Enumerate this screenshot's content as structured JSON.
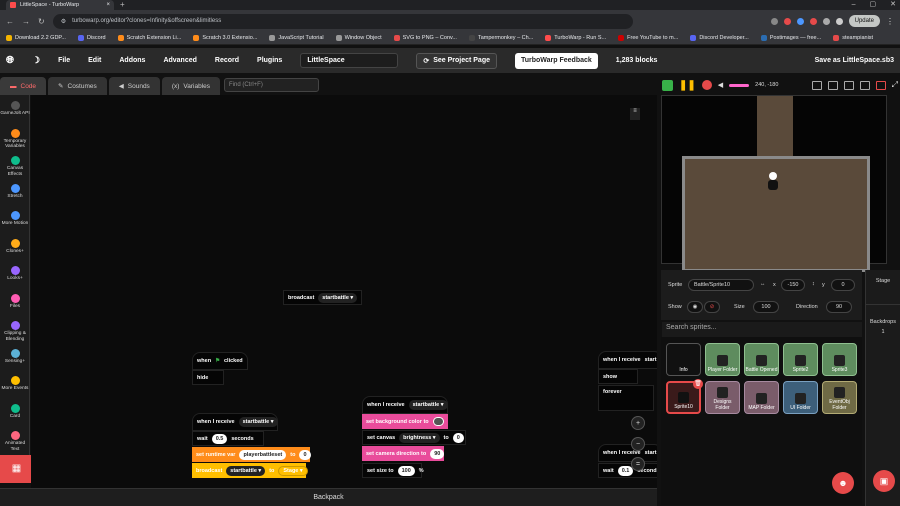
{
  "browser": {
    "tab_title": "LittleSpace - TurboWarp",
    "url": "turbowarp.org/editor?clones=Infinity&offscreen&limitless",
    "update_label": "Update",
    "bookmarks": [
      {
        "label": "Download 2.2 GDP...",
        "color": "#f4b400"
      },
      {
        "label": "Discord",
        "color": "#5865f2"
      },
      {
        "label": "Scratch Extension Li...",
        "color": "#ff8c1a"
      },
      {
        "label": "Scratch 3.0 Extensio...",
        "color": "#ff8c1a"
      },
      {
        "label": "JavaScript Tutorial",
        "color": "#999"
      },
      {
        "label": "Window Object",
        "color": "#999"
      },
      {
        "label": "SVG to PNG – Conv...",
        "color": "#e64a4a"
      },
      {
        "label": "Tampermonkey – Ch...",
        "color": "#444"
      },
      {
        "label": "TurboWarp - Run S...",
        "color": "#ff4c4c"
      },
      {
        "label": "Free YouTube to m...",
        "color": "#cc0000"
      },
      {
        "label": "Discord Developer...",
        "color": "#5865f2"
      },
      {
        "label": "Postimages — free...",
        "color": "#2b6cb0"
      },
      {
        "label": "steampianist",
        "color": "#e64a4a"
      }
    ]
  },
  "menu": {
    "file": "File",
    "edit": "Edit",
    "addons": "Addons",
    "advanced": "Advanced",
    "record": "Record",
    "plugins": "Plugins",
    "project_name": "LittleSpace",
    "see_project": "See Project Page",
    "feedback": "TurboWarp Feedback",
    "blocks_count": "1,283 blocks",
    "save_as": "Save as LittleSpace.sb3"
  },
  "editor_tabs": {
    "code": "Code",
    "costumes": "Costumes",
    "sounds": "Sounds",
    "variables": "Variables"
  },
  "find_placeholder": "Find (Ctrl+F)",
  "categories": [
    {
      "label": "GameJolt API",
      "color": "#555"
    },
    {
      "label": "Temporary Variables",
      "color": "#ff8c1a"
    },
    {
      "label": "Canvas Effects",
      "color": "#0fbd8c"
    },
    {
      "label": "Stretch",
      "color": "#4c97ff"
    },
    {
      "label": "More Motion",
      "color": "#4c97ff"
    },
    {
      "label": "Clones+",
      "color": "#ffab19"
    },
    {
      "label": "Looks+",
      "color": "#9966ff"
    },
    {
      "label": "Files",
      "color": "#ff5cb3"
    },
    {
      "label": "Clipping & Blending",
      "color": "#9966ff"
    },
    {
      "label": "Sensing+",
      "color": "#5cb1d6"
    },
    {
      "label": "More Events",
      "color": "#ffbf00"
    },
    {
      "label": "Card",
      "color": "#0fbd8c"
    },
    {
      "label": "Animated Text",
      "color": "#ff6680"
    }
  ],
  "blocks": {
    "broadcast_top": "broadcast",
    "msg_startbattle": "startbattle ▾",
    "when_flag": "when",
    "clicked": "clicked",
    "hide": "hide",
    "when_receive": "when I receive",
    "wait": "wait",
    "wait_val": "0.5",
    "seconds": "seconds",
    "set_runtime": "set runtime var",
    "runtime_var": "playerbattleset",
    "to": "to",
    "zero": "0",
    "broadcast": "broadcast",
    "startbattle": "startbattle ▾",
    "stage": "Stage ▾",
    "set_bg": "set background color to",
    "set_canvas": "set canvas",
    "brightness": "brightness ▾",
    "set_canvas_val": "0",
    "set_cam": "set camera direction to",
    "cam_val": "90",
    "set_size": "set size to",
    "size_val": "100",
    "percent": "%",
    "when_receive_right": "when I receive",
    "start_trunc": "start",
    "show": "show",
    "forever": "forever",
    "wait_right": "wait",
    "wait_right_val": "0.1",
    "seconds_right": "seconds"
  },
  "backpack": "Backpack",
  "stage_coords": "240, -180",
  "sprite_info": {
    "sprite_label": "Sprite",
    "sprite_name": "Battle/Sprite10",
    "x_label": "x",
    "x_val": "-150",
    "y_label": "y",
    "y_val": "0",
    "show_label": "Show",
    "size_label": "Size",
    "size_val": "100",
    "direction_label": "Direction",
    "direction_val": "90"
  },
  "search_sprites_placeholder": "Search sprites...",
  "sprites": [
    {
      "label": "Info",
      "kind": "plain"
    },
    {
      "label": "Player Folder",
      "kind": "folder"
    },
    {
      "label": "Battle Opened",
      "kind": "folder"
    },
    {
      "label": "Sprite2",
      "kind": "folder"
    },
    {
      "label": "Sprite3",
      "kind": "folder"
    },
    {
      "label": "Sprite10",
      "kind": "selected"
    },
    {
      "label": "Designs Folder",
      "kind": "brown"
    },
    {
      "label": "MAP Folder",
      "kind": "brown"
    },
    {
      "label": "UI Folder",
      "kind": "blue"
    },
    {
      "label": "EventObj Folder",
      "kind": "tan"
    }
  ],
  "stage_pane": {
    "title": "Stage",
    "backdrops_label": "Backdrops",
    "backdrops_count": "1"
  }
}
